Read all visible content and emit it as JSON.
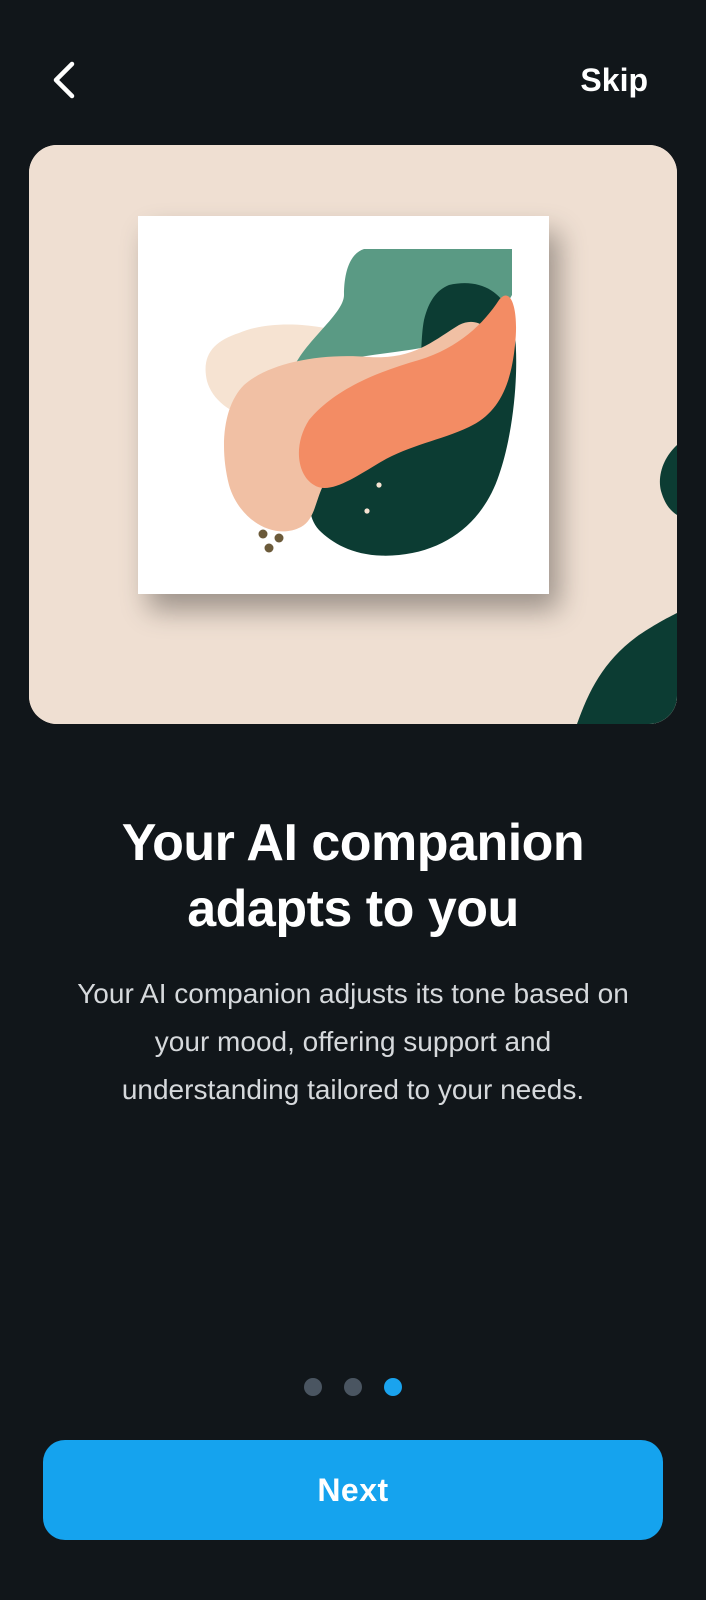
{
  "header": {
    "back_icon": "chevron-left-icon",
    "skip_label": "Skip"
  },
  "hero": {
    "image_description_icon": "abstract-art-illustration",
    "colors": {
      "card_background": "#efdfd2",
      "teal": "#5a9a84",
      "dark_green": "#0c3c33",
      "peach": "#f1c0a4",
      "orange": "#f38c64",
      "cream": "#f6e3d2"
    }
  },
  "content": {
    "title_line1": "Your AI companion",
    "title_line2": "adapts to you",
    "description_line1": "Your AI companion adjusts its tone based on",
    "description_line2": "your mood, offering support and",
    "description_line3": "understanding tailored to your needs."
  },
  "pagination": {
    "total": 3,
    "current": 3,
    "active_color": "#1aa3ee",
    "inactive_color": "#4a5561"
  },
  "footer": {
    "next_label": "Next",
    "button_color": "#15a3ee"
  }
}
